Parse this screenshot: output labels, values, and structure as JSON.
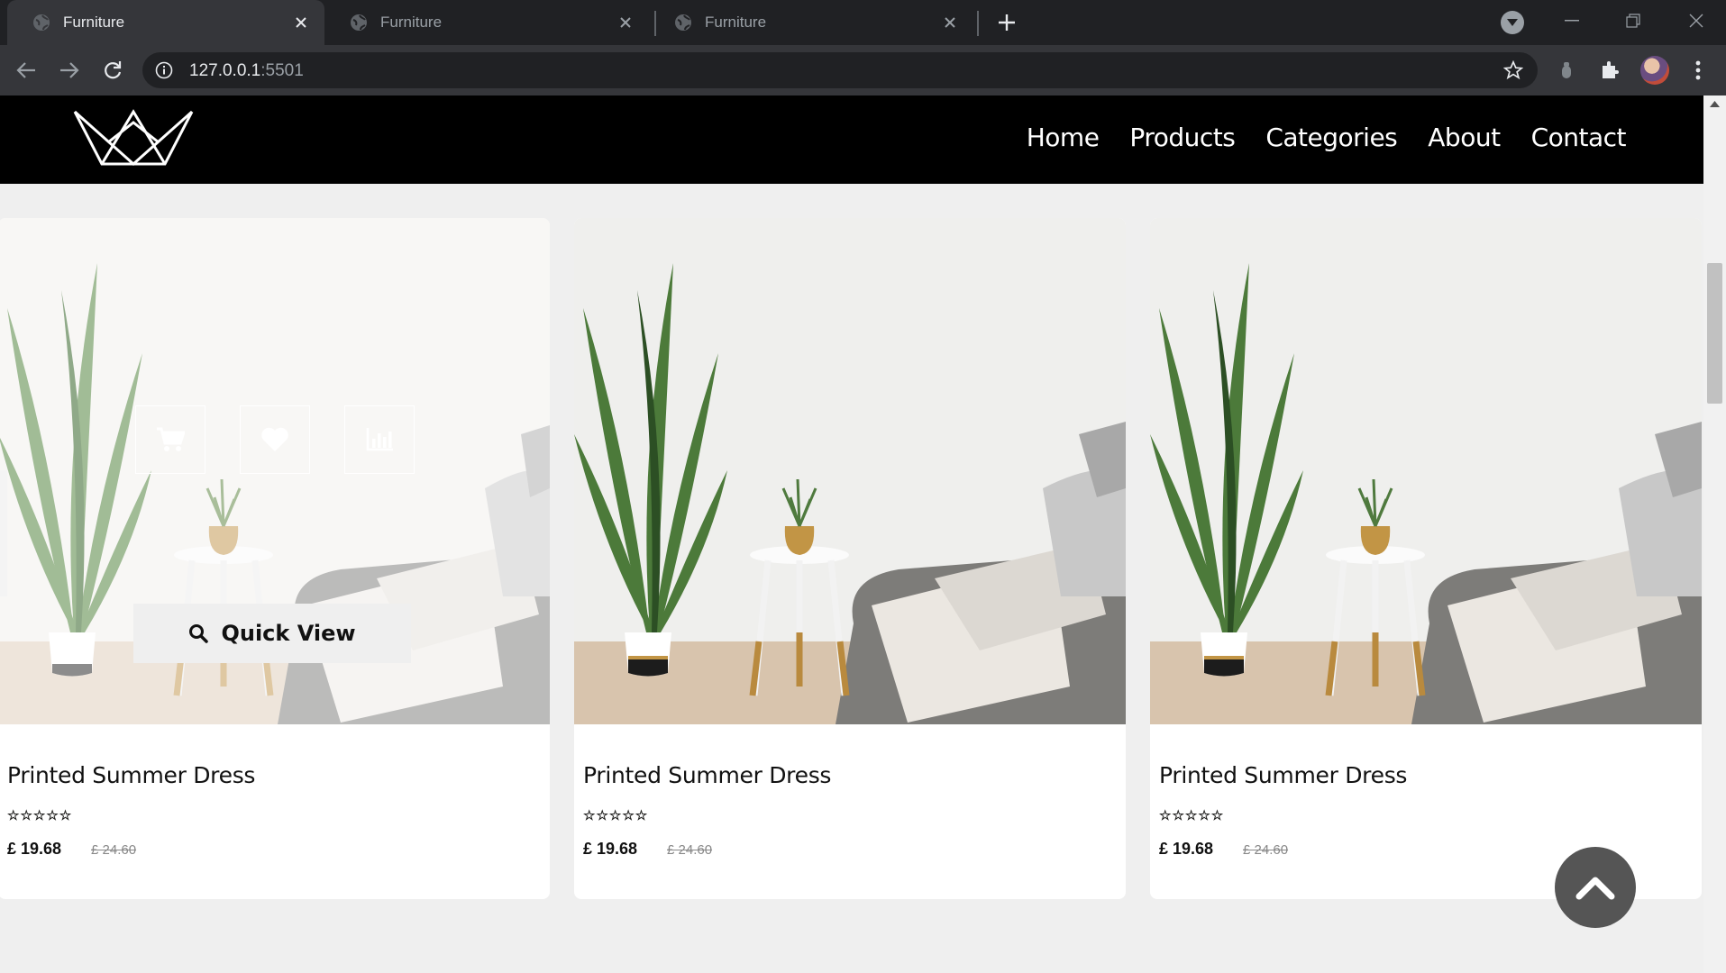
{
  "browser": {
    "tabs": [
      {
        "title": "Furniture",
        "active": true
      },
      {
        "title": "Furniture",
        "active": false
      },
      {
        "title": "Furniture",
        "active": false
      }
    ],
    "url_host": "127.0.0.1",
    "url_port": ":5501"
  },
  "site": {
    "nav": [
      "Home",
      "Products",
      "Categories",
      "About",
      "Contact"
    ],
    "quick_view_label": "Quick View",
    "products": [
      {
        "name": "Printed Summer Dress",
        "rating": 5,
        "stars": "☆☆☆☆☆",
        "price": "£ 19.68",
        "old_price": "£ 24.60"
      },
      {
        "name": "Printed Summer Dress",
        "rating": 5,
        "stars": "☆☆☆☆☆",
        "price": "£ 19.68",
        "old_price": "£ 24.60"
      },
      {
        "name": "Printed Summer Dress",
        "rating": 5,
        "stars": "☆☆☆☆☆",
        "price": "£ 19.68",
        "old_price": "£ 24.60"
      }
    ]
  },
  "colors": {
    "header_bg": "#000000",
    "page_bg": "#efefef",
    "scroll_top_bg": "#555555",
    "star_color": "#e0a800"
  }
}
